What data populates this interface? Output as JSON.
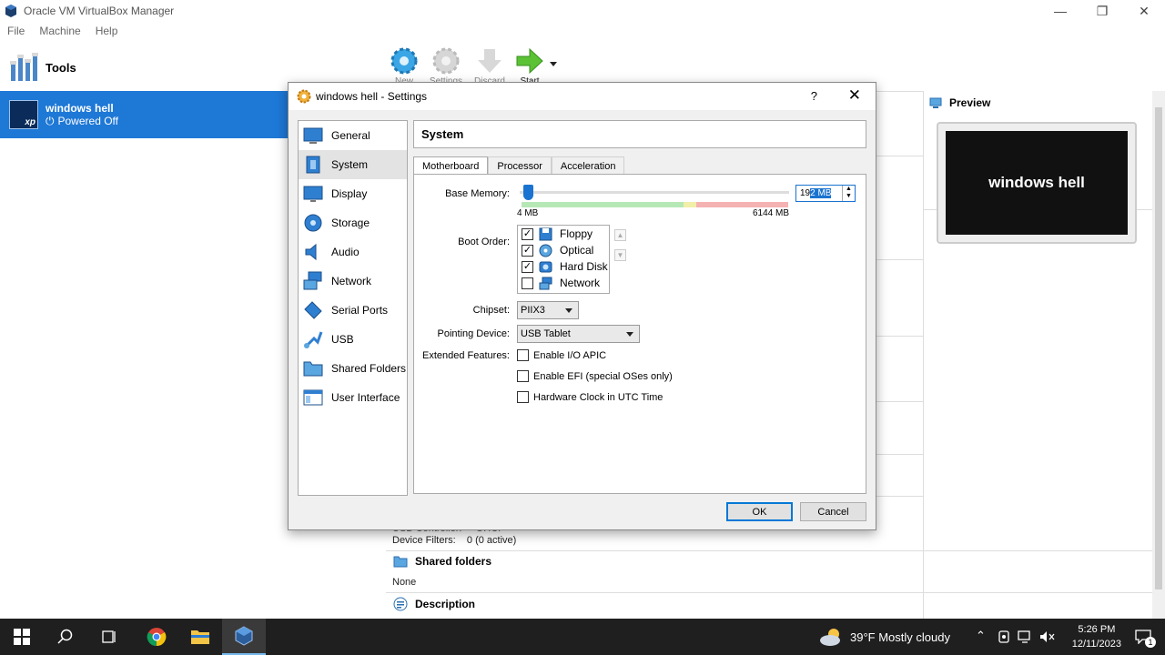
{
  "window": {
    "title": "Oracle VM VirtualBox Manager",
    "menu": [
      "File",
      "Machine",
      "Help"
    ]
  },
  "sidebar": {
    "tools_label": "Tools",
    "vm": {
      "name": "windows hell",
      "state": "Powered Off",
      "os_badge": "xp"
    }
  },
  "toolbar": {
    "new": "New",
    "settings": "Settings",
    "discard": "Discard",
    "start": "Start"
  },
  "details": {
    "preview_title": "Preview",
    "preview_vm_name": "windows hell",
    "usb_controller_label": "USB Controller:",
    "usb_controller_value": "OHCI",
    "device_filters_label": "Device Filters:",
    "device_filters_value": "0 (0 active)",
    "shared_folders_title": "Shared folders",
    "shared_folders_value": "None",
    "description_title": "Description"
  },
  "dialog": {
    "title": "windows hell - Settings",
    "help": "?",
    "categories": [
      "General",
      "System",
      "Display",
      "Storage",
      "Audio",
      "Network",
      "Serial Ports",
      "USB",
      "Shared Folders",
      "User Interface"
    ],
    "selected_category": "System",
    "page_title": "System",
    "tabs": [
      "Motherboard",
      "Processor",
      "Acceleration"
    ],
    "active_tab": "Motherboard",
    "base_memory_label": "Base Memory:",
    "base_memory_min": "4 MB",
    "base_memory_max": "6144 MB",
    "base_memory_value_prefix": "19",
    "base_memory_value_selected": "2 MB",
    "boot_order_label": "Boot Order:",
    "boot_items": [
      {
        "label": "Floppy",
        "checked": true,
        "icon": "floppy-icon"
      },
      {
        "label": "Optical",
        "checked": true,
        "icon": "optical-disc-icon"
      },
      {
        "label": "Hard Disk",
        "checked": true,
        "icon": "hard-disk-icon"
      },
      {
        "label": "Network",
        "checked": false,
        "icon": "network-icon"
      }
    ],
    "chipset_label": "Chipset:",
    "chipset_value": "PIIX3",
    "pointing_label": "Pointing Device:",
    "pointing_value": "USB Tablet",
    "extended_label": "Extended Features:",
    "features": [
      {
        "label": "Enable I/O APIC",
        "checked": false
      },
      {
        "label": "Enable EFI (special OSes only)",
        "checked": false
      },
      {
        "label": "Hardware Clock in UTC Time",
        "checked": false
      }
    ],
    "ok": "OK",
    "cancel": "Cancel"
  },
  "taskbar": {
    "weather": "39°F  Mostly cloudy",
    "time": "5:26 PM",
    "date": "12/11/2023",
    "notification_count": "1"
  }
}
